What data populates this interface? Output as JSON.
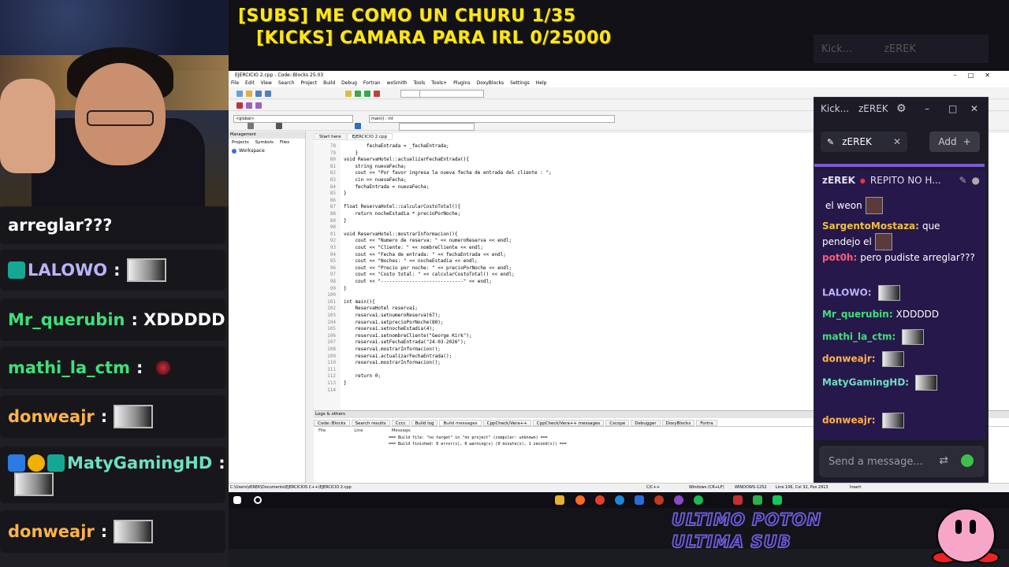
{
  "stream": {
    "goal_subs": "[SUBS] ME COMO UN CHURU 1/35",
    "goal_kicks": "[KICKS] CAMARA PARA IRL 0/25000",
    "overlay_bottom_1": "ULTIMO POTON",
    "overlay_bottom_2": "ULTIMA SUB"
  },
  "overlay_chat": [
    {
      "user": "",
      "text": "arreglar???",
      "color": "#ffffff",
      "badges": [],
      "emote": ""
    },
    {
      "user": "LALOWO",
      "text": ":",
      "color": "#b9b3ff",
      "badges": [
        "teal"
      ],
      "emote": "box"
    },
    {
      "user": "Mr_querubin",
      "text": ": XDDDDD",
      "color": "#3fe07a",
      "badges": [],
      "emote": ""
    },
    {
      "user": "mathi_la_ctm",
      "text": ":",
      "color": "#3fe07a",
      "badges": [],
      "emote": "small"
    },
    {
      "user": "donweajr",
      "text": ":",
      "color": "#ffb347",
      "badges": [],
      "emote": "box"
    },
    {
      "user": "MatyGamingHD",
      "text": ":",
      "color": "#6fe0c0",
      "badges": [
        "blue",
        "gold",
        "teal"
      ],
      "emote": "box"
    },
    {
      "user": "donweajr",
      "text": ":",
      "color": "#ffb347",
      "badges": [],
      "emote": "box"
    }
  ],
  "codeblocks": {
    "title": "EJERCICIO 2.cpp - Code::Blocks 25.03",
    "menu": [
      "File",
      "Edit",
      "View",
      "Search",
      "Project",
      "Build",
      "Debug",
      "Fortran",
      "wxSmith",
      "Tools",
      "Tools+",
      "Plugins",
      "DoxyBlocks",
      "Settings",
      "Help"
    ],
    "scope_combo": "<global>",
    "symbol_combo": "main() : int",
    "management": {
      "title": "Management",
      "tabs": [
        "Projects",
        "Symbols",
        "Files"
      ],
      "workspace": "Workspace"
    },
    "editor_tabs": [
      "Start here",
      "EJERCICIO 2.cpp"
    ],
    "code_lines": [
      {
        "n": "78",
        "t": "        fechaEntrada = _fechaEntrada;"
      },
      {
        "n": "79",
        "t": "    }"
      },
      {
        "n": "80",
        "t": "void ReservaHotel::actualizarFechaEntrada(){"
      },
      {
        "n": "81",
        "t": "    string nuevaFecha;"
      },
      {
        "n": "82",
        "t": "    cout << \"Por favor ingresa la nueva fecha de entrada del cliente : \";"
      },
      {
        "n": "83",
        "t": "    cin >> nuevaFecha;"
      },
      {
        "n": "84",
        "t": "    fechaEntrada = nuevaFecha;"
      },
      {
        "n": "85",
        "t": "}"
      },
      {
        "n": "86",
        "t": ""
      },
      {
        "n": "87",
        "t": "float ReservaHotel::calcularCostoTotal(){"
      },
      {
        "n": "88",
        "t": "    return nocheEstadia * precioPorNoche;"
      },
      {
        "n": "89",
        "t": "}"
      },
      {
        "n": "90",
        "t": ""
      },
      {
        "n": "91",
        "t": "void ReservaHotel::mostrarInformacion(){"
      },
      {
        "n": "92",
        "t": "    cout << \"Numero de reserva: \" << numeroReserva << endl;"
      },
      {
        "n": "93",
        "t": "    cout << \"Cliente: \" << nombreCliente << endl;"
      },
      {
        "n": "94",
        "t": "    cout << \"Fecha de entrada: \" << fechaEntrada << endl;"
      },
      {
        "n": "95",
        "t": "    cout << \"Noches: \" << nocheEstadia << endl;"
      },
      {
        "n": "96",
        "t": "    cout << \"Precio por noche: \" << precioPorNoche << endl;"
      },
      {
        "n": "97",
        "t": "    cout << \"Costo total: \" << calcularCostoTotal() << endl;"
      },
      {
        "n": "98",
        "t": "    cout << \"-----------------------------\" << endl;"
      },
      {
        "n": "99",
        "t": "}"
      },
      {
        "n": "100",
        "t": ""
      },
      {
        "n": "101",
        "t": "int main(){"
      },
      {
        "n": "102",
        "t": "    ReservaHotel reserva1;"
      },
      {
        "n": "103",
        "t": "    reserva1.setnumeroReserva(67);"
      },
      {
        "n": "104",
        "t": "    reserva1.setprecioPorNoche(80);"
      },
      {
        "n": "105",
        "t": "    reserva1.setnocheEstadia(4);"
      },
      {
        "n": "106",
        "t": "    reserva1.setnombreCliente(\"George Kirk\");"
      },
      {
        "n": "107",
        "t": "    reserva1.setFechaEntrada(\"24-03-2026\");"
      },
      {
        "n": "108",
        "t": "    reserva1.mostrarInformacion();"
      },
      {
        "n": "109",
        "t": "    reserva1.actualizarFechaEntrada();"
      },
      {
        "n": "110",
        "t": "    reserva1.mostrarInformacion();"
      },
      {
        "n": "111",
        "t": ""
      },
      {
        "n": "112",
        "t": "    return 0;"
      },
      {
        "n": "113",
        "t": "}"
      },
      {
        "n": "114",
        "t": ""
      }
    ],
    "logs": {
      "title": "Logs & others",
      "tabs": [
        "Code::Blocks",
        "Search results",
        "Cccc",
        "Build log",
        "Build messages",
        "CppCheck/Vera++",
        "CppCheck/Vera++ messages",
        "Cscope",
        "Debugger",
        "DoxyBlocks",
        "Fortra"
      ],
      "active_tab": "Build messages",
      "head_file": "File",
      "head_line": "Line",
      "head_message": "Message",
      "lines": [
        "=== Build file: \"no target\" in \"no project\" (compiler: unknown) ===",
        "=== Build finished: 0 error(s), 0 warning(s) (0 minute(s), 1 second(s)) ==="
      ]
    },
    "status": {
      "path": "C:\\Users\\zEREK\\Documents\\EJERCICIOS C++\\EJERCICIO 2.cpp",
      "lang": "C/C++",
      "eol": "Windows (CR+LF)",
      "encoding": "WINDOWS-1252",
      "position": "Line 106, Col 32, Pos 2913",
      "mode": "Insert"
    }
  },
  "kick": {
    "title": "Kick...",
    "channel": "zEREK",
    "tab_label": "zEREK",
    "add_label": "Add",
    "header_user": "zEREK",
    "header_text": "REPITO NO H...",
    "messages": [
      {
        "user": "",
        "text": "el weon",
        "color": "#ffffff",
        "avatar": true
      },
      {
        "user": "SargentoMostaza:",
        "text": "que pendejo el",
        "color": "#f0c040",
        "avatar": true
      },
      {
        "user": "pot0h:",
        "text": "pero pudiste arreglar???",
        "color": "#ff5a7a",
        "avatar": false
      },
      {
        "user": "LALOWO:",
        "text": "",
        "color": "#b9b3ff",
        "avatar": false
      },
      {
        "user": "Mr_querubin:",
        "text": "XDDDDD",
        "color": "#3fe07a",
        "avatar": false
      },
      {
        "user": "mathi_la_ctm:",
        "text": "",
        "color": "#3fe07a",
        "avatar": false
      },
      {
        "user": "donweajr:",
        "text": "",
        "color": "#ffb347",
        "avatar": false
      },
      {
        "user": "MatyGamingHD:",
        "text": "",
        "color": "#6fe0c0",
        "avatar": false
      },
      {
        "user": "donweajr:",
        "text": "",
        "color": "#ffb347",
        "avatar": false
      }
    ],
    "input_placeholder": "Send a message..."
  },
  "colors": {
    "accent": "#7b5ad8",
    "goal": "#ffe61a",
    "kick_green": "#3fbf4a"
  }
}
